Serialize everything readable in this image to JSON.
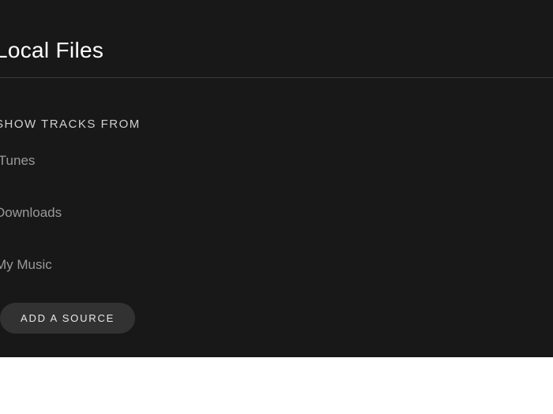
{
  "header": {
    "title": "Local Files"
  },
  "section": {
    "label": "SHOW TRACKS FROM"
  },
  "sources": [
    {
      "label": "iTunes"
    },
    {
      "label": "Downloads"
    },
    {
      "label": "My Music"
    }
  ],
  "actions": {
    "add_source": "ADD A SOURCE"
  }
}
